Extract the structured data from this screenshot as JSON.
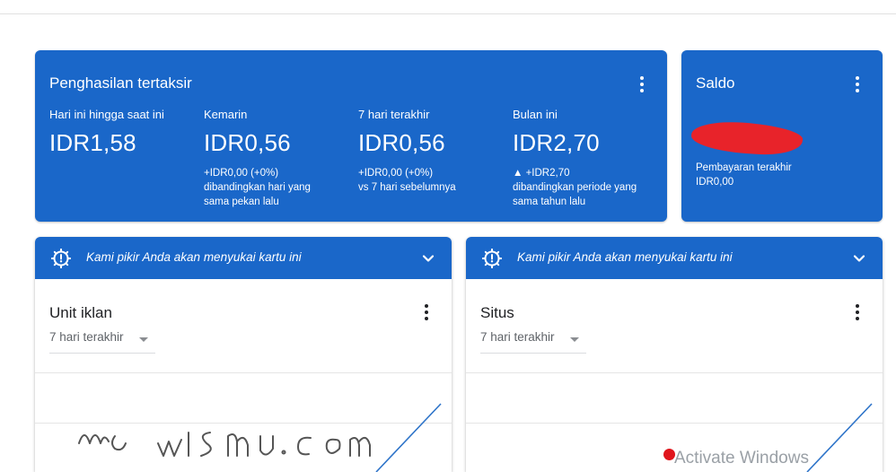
{
  "earnings": {
    "title": "Penghasilan tertaksir",
    "metrics": [
      {
        "label": "Hari ini hingga saat ini",
        "value": "IDR1,58",
        "compare": []
      },
      {
        "label": "Kemarin",
        "value": "IDR0,56",
        "compare": [
          "+IDR0,00 (+0%)",
          "dibandingkan hari yang",
          "sama pekan lalu"
        ]
      },
      {
        "label": "7 hari terakhir",
        "value": "IDR0,56",
        "compare": [
          "+IDR0,00 (+0%)",
          "vs 7 hari sebelumnya"
        ]
      },
      {
        "label": "Bulan ini",
        "value": "IDR2,70",
        "compare": [
          "▲ +IDR2,70",
          "dibandingkan periode yang",
          "sama tahun lalu"
        ]
      }
    ]
  },
  "balance": {
    "title": "Saldo",
    "last_payment_label": "Pembayaran terakhir",
    "last_payment_value": "IDR0,00"
  },
  "cards": [
    {
      "banner": "Kami pikir Anda akan menyukai kartu ini",
      "title": "Unit iklan",
      "range": "7 hari terakhir"
    },
    {
      "banner": "Kami pikir Anda akan menyukai kartu ini",
      "title": "Situs",
      "range": "7 hari terakhir"
    }
  ],
  "overlay": {
    "activate": "Activate Windows"
  },
  "colors": {
    "primary": "#1a67c9",
    "redaction": "#e8232a",
    "line": "#2e74c9"
  }
}
